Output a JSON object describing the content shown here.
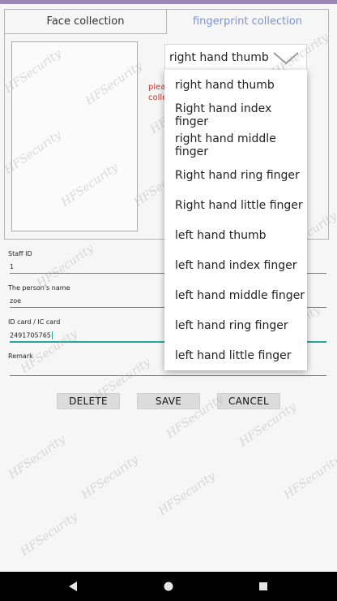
{
  "tabs": [
    {
      "label": "Face collection",
      "active": false
    },
    {
      "label": "fingerprint collection",
      "active": true
    }
  ],
  "finger_select": {
    "selected": "right hand thumb"
  },
  "hint_text": "plea\ncolle",
  "dropdown_options": [
    "right hand thumb",
    "Right hand index finger",
    "right hand middle finger",
    "Right hand ring finger",
    "Right hand little finger",
    "left hand thumb",
    "left hand index finger",
    "left hand middle finger",
    "left hand ring finger",
    "left hand little finger"
  ],
  "fields": {
    "staff_id": {
      "label": "Staff ID",
      "value": "1"
    },
    "name": {
      "label": "The person's name",
      "value": "zoe"
    },
    "id_card": {
      "label": "ID card / IC card",
      "value": "2491705765"
    },
    "remark": {
      "label": "Remark",
      "value": ""
    }
  },
  "buttons": {
    "delete": "DELETE",
    "save": "SAVE",
    "cancel": "CANCEL"
  },
  "watermark": "HFSecurity",
  "colors": {
    "accent_tab": "#7d93d8",
    "hint": "#d0312d",
    "focus_underline": "#26a69a",
    "top_bar": "#9b86b8"
  },
  "nav_icons": [
    "back-icon",
    "home-icon",
    "recents-icon"
  ]
}
